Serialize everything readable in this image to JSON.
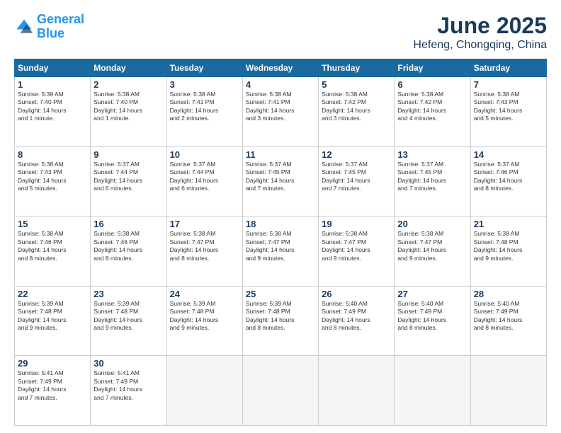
{
  "header": {
    "logo_line1": "General",
    "logo_line2": "Blue",
    "title": "June 2025",
    "subtitle": "Hefeng, Chongqing, China"
  },
  "weekdays": [
    "Sunday",
    "Monday",
    "Tuesday",
    "Wednesday",
    "Thursday",
    "Friday",
    "Saturday"
  ],
  "weeks": [
    [
      {
        "day": "1",
        "info": "Sunrise: 5:39 AM\nSunset: 7:40 PM\nDaylight: 14 hours\nand 1 minute."
      },
      {
        "day": "2",
        "info": "Sunrise: 5:38 AM\nSunset: 7:40 PM\nDaylight: 14 hours\nand 1 minute."
      },
      {
        "day": "3",
        "info": "Sunrise: 5:38 AM\nSunset: 7:41 PM\nDaylight: 14 hours\nand 2 minutes."
      },
      {
        "day": "4",
        "info": "Sunrise: 5:38 AM\nSunset: 7:41 PM\nDaylight: 14 hours\nand 3 minutes."
      },
      {
        "day": "5",
        "info": "Sunrise: 5:38 AM\nSunset: 7:42 PM\nDaylight: 14 hours\nand 3 minutes."
      },
      {
        "day": "6",
        "info": "Sunrise: 5:38 AM\nSunset: 7:42 PM\nDaylight: 14 hours\nand 4 minutes."
      },
      {
        "day": "7",
        "info": "Sunrise: 5:38 AM\nSunset: 7:43 PM\nDaylight: 14 hours\nand 5 minutes."
      }
    ],
    [
      {
        "day": "8",
        "info": "Sunrise: 5:38 AM\nSunset: 7:43 PM\nDaylight: 14 hours\nand 5 minutes."
      },
      {
        "day": "9",
        "info": "Sunrise: 5:37 AM\nSunset: 7:44 PM\nDaylight: 14 hours\nand 6 minutes."
      },
      {
        "day": "10",
        "info": "Sunrise: 5:37 AM\nSunset: 7:44 PM\nDaylight: 14 hours\nand 6 minutes."
      },
      {
        "day": "11",
        "info": "Sunrise: 5:37 AM\nSunset: 7:45 PM\nDaylight: 14 hours\nand 7 minutes."
      },
      {
        "day": "12",
        "info": "Sunrise: 5:37 AM\nSunset: 7:45 PM\nDaylight: 14 hours\nand 7 minutes."
      },
      {
        "day": "13",
        "info": "Sunrise: 5:37 AM\nSunset: 7:45 PM\nDaylight: 14 hours\nand 7 minutes."
      },
      {
        "day": "14",
        "info": "Sunrise: 5:37 AM\nSunset: 7:46 PM\nDaylight: 14 hours\nand 8 minutes."
      }
    ],
    [
      {
        "day": "15",
        "info": "Sunrise: 5:38 AM\nSunset: 7:46 PM\nDaylight: 14 hours\nand 8 minutes."
      },
      {
        "day": "16",
        "info": "Sunrise: 5:38 AM\nSunset: 7:46 PM\nDaylight: 14 hours\nand 8 minutes."
      },
      {
        "day": "17",
        "info": "Sunrise: 5:38 AM\nSunset: 7:47 PM\nDaylight: 14 hours\nand 8 minutes."
      },
      {
        "day": "18",
        "info": "Sunrise: 5:38 AM\nSunset: 7:47 PM\nDaylight: 14 hours\nand 9 minutes."
      },
      {
        "day": "19",
        "info": "Sunrise: 5:38 AM\nSunset: 7:47 PM\nDaylight: 14 hours\nand 9 minutes."
      },
      {
        "day": "20",
        "info": "Sunrise: 5:38 AM\nSunset: 7:47 PM\nDaylight: 14 hours\nand 9 minutes."
      },
      {
        "day": "21",
        "info": "Sunrise: 5:38 AM\nSunset: 7:48 PM\nDaylight: 14 hours\nand 9 minutes."
      }
    ],
    [
      {
        "day": "22",
        "info": "Sunrise: 5:39 AM\nSunset: 7:48 PM\nDaylight: 14 hours\nand 9 minutes."
      },
      {
        "day": "23",
        "info": "Sunrise: 5:39 AM\nSunset: 7:48 PM\nDaylight: 14 hours\nand 9 minutes."
      },
      {
        "day": "24",
        "info": "Sunrise: 5:39 AM\nSunset: 7:48 PM\nDaylight: 14 hours\nand 9 minutes."
      },
      {
        "day": "25",
        "info": "Sunrise: 5:39 AM\nSunset: 7:48 PM\nDaylight: 14 hours\nand 8 minutes."
      },
      {
        "day": "26",
        "info": "Sunrise: 5:40 AM\nSunset: 7:49 PM\nDaylight: 14 hours\nand 8 minutes."
      },
      {
        "day": "27",
        "info": "Sunrise: 5:40 AM\nSunset: 7:49 PM\nDaylight: 14 hours\nand 8 minutes."
      },
      {
        "day": "28",
        "info": "Sunrise: 5:40 AM\nSunset: 7:49 PM\nDaylight: 14 hours\nand 8 minutes."
      }
    ],
    [
      {
        "day": "29",
        "info": "Sunrise: 5:41 AM\nSunset: 7:49 PM\nDaylight: 14 hours\nand 7 minutes."
      },
      {
        "day": "30",
        "info": "Sunrise: 5:41 AM\nSunset: 7:49 PM\nDaylight: 14 hours\nand 7 minutes."
      },
      {
        "day": "",
        "info": ""
      },
      {
        "day": "",
        "info": ""
      },
      {
        "day": "",
        "info": ""
      },
      {
        "day": "",
        "info": ""
      },
      {
        "day": "",
        "info": ""
      }
    ]
  ]
}
